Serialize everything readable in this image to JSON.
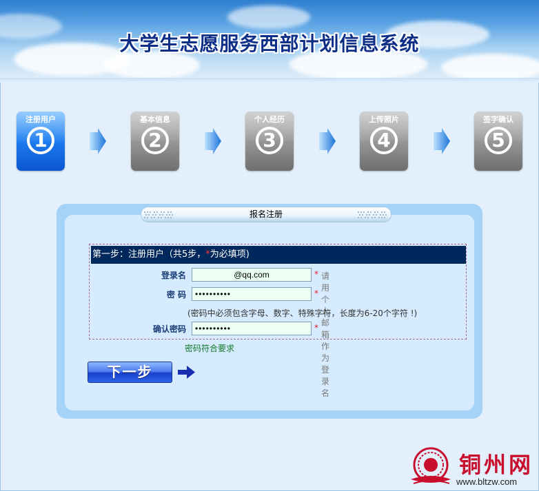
{
  "banner": {
    "title": "大学生志愿服务西部计划信息系统"
  },
  "steps": [
    {
      "label": "注册用户",
      "num": "1",
      "active": true
    },
    {
      "label": "基本信息",
      "num": "2",
      "active": false
    },
    {
      "label": "个人经历",
      "num": "3",
      "active": false
    },
    {
      "label": "上传照片",
      "num": "4",
      "active": false
    },
    {
      "label": "签字确认",
      "num": "5",
      "active": false
    }
  ],
  "panel": {
    "tab_title": "报名注册",
    "heading_prefix": "第一步：注册用户（共5步，",
    "heading_star": "*",
    "heading_suffix": "为必填项)",
    "fields": {
      "login": {
        "label": "登录名",
        "value": "@qq.com",
        "hint": "请用个人邮箱作为登录名"
      },
      "password": {
        "label": "密 码",
        "value": "••••••••••"
      },
      "confirm": {
        "label": "确认密码",
        "value": "••••••••••"
      }
    },
    "required_mark": "*",
    "password_note": "(密码中必须包含字母、数字、特殊字符，长度为6-20个字符 !)",
    "password_ok": "密码符合要求",
    "next_label": "下一步"
  },
  "logo": {
    "text": "铜州网",
    "url": "www.bltzw.com"
  },
  "colors": {
    "accent": "#00285c",
    "required": "#e0202e",
    "ok": "#12782a",
    "step_active": "#1f7ff0",
    "step_inactive": "#9a9a9a"
  }
}
